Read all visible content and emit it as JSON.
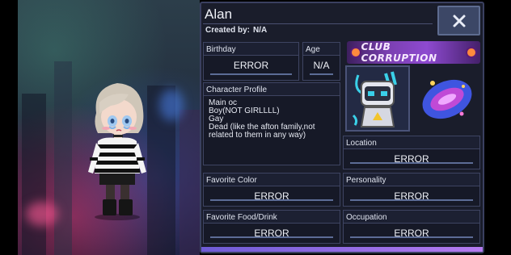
{
  "character": {
    "name": "Alan",
    "created_by_label": "Created by:",
    "created_by_value": "N/A"
  },
  "buttons": {
    "close_label": "X"
  },
  "fields": {
    "birthday": {
      "label": "Birthday",
      "value": "ERROR"
    },
    "age": {
      "label": "Age",
      "value": "N/A"
    },
    "profile": {
      "label": "Character Profile",
      "text": "Main oc\nBoy(NOT GIRLLLL)\nGay\nDead (like the afton family,not related to them in any way)"
    },
    "location": {
      "label": "Location",
      "value": "ERROR"
    },
    "favorite_color": {
      "label": "Favorite Color",
      "value": "ERROR"
    },
    "personality": {
      "label": "Personality",
      "value": "ERROR"
    },
    "favorite_food": {
      "label": "Favorite Food/Drink",
      "value": "ERROR"
    },
    "occupation": {
      "label": "Occupation",
      "value": "ERROR"
    }
  },
  "club": {
    "name": "CLUB CORRUPTION"
  },
  "icons": {
    "close": "close-icon",
    "pet": "robot-pet-icon",
    "item": "portal-ring-icon"
  },
  "colors": {
    "panel_bg": "#1a1d2b",
    "field_border": "#3e4462",
    "accent": "#8e4ad0",
    "close_button": "#3c4766"
  }
}
